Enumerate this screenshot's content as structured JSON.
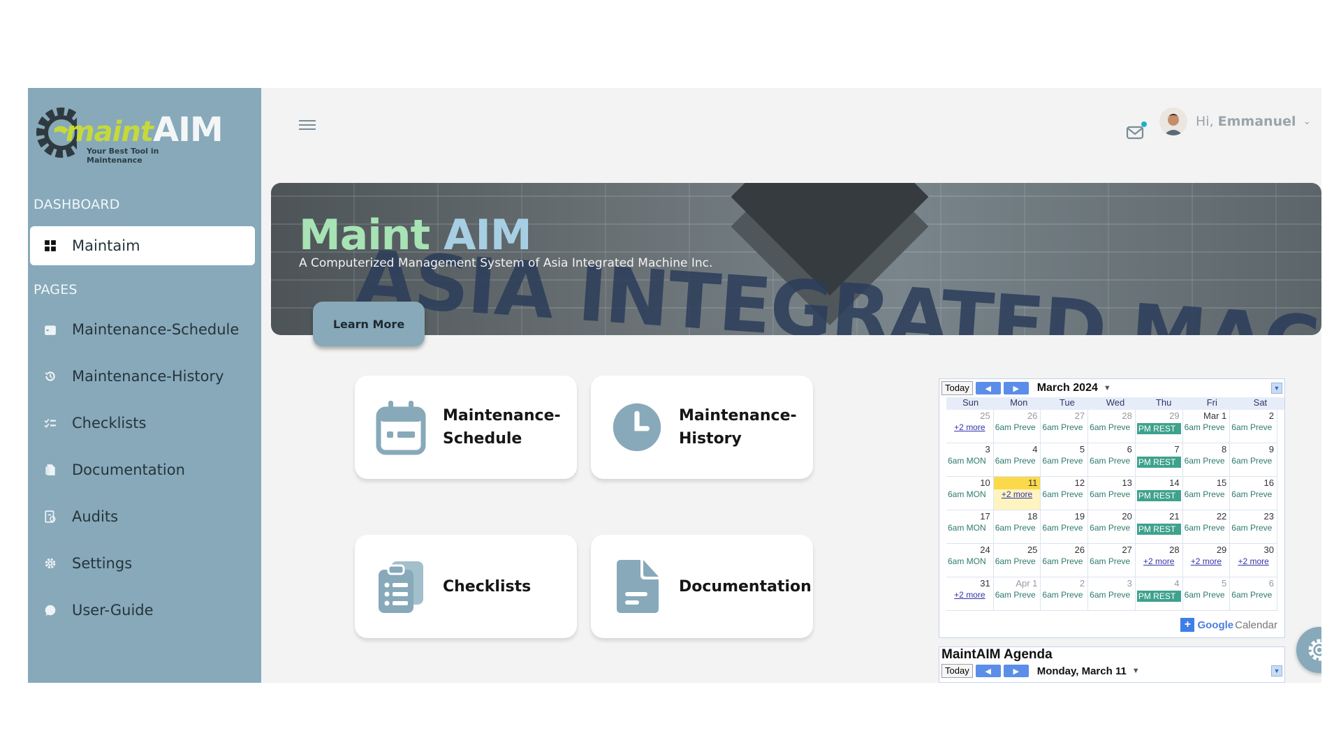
{
  "logo": {
    "word_a": "maint",
    "word_b": "AIM",
    "tagline": "Your Best Tool in Maintenance"
  },
  "sidebar": {
    "dashboard_heading": "DASHBOARD",
    "pages_heading": "PAGES",
    "active_item": {
      "label": "Maintaim",
      "icon": "grid-icon"
    },
    "items": [
      {
        "label": "Maintenance-Schedule",
        "icon": "calendar-icon"
      },
      {
        "label": "Maintenance-History",
        "icon": "history-icon"
      },
      {
        "label": "Checklists",
        "icon": "checklist-icon"
      },
      {
        "label": "Documentation",
        "icon": "document-icon"
      },
      {
        "label": "Audits",
        "icon": "audit-icon"
      },
      {
        "label": "Settings",
        "icon": "gear-icon"
      },
      {
        "label": "User-Guide",
        "icon": "chat-icon"
      }
    ]
  },
  "topbar": {
    "greeting_prefix": "Hi,",
    "user_name": "Emmanuel",
    "notification_dot": true
  },
  "banner": {
    "title_a": "Maint",
    "title_b": "AIM",
    "subtitle": "A Computerized Management System of Asia Integrated Machine Inc.",
    "background_text": "ASIA INTEGRATED MACHINE",
    "learn_more": "Learn More"
  },
  "cards": [
    {
      "line1": "Maintenance-",
      "line2": "Schedule",
      "icon": "calendar-icon"
    },
    {
      "line1": "Maintenance-",
      "line2": "History",
      "icon": "clock-icon"
    },
    {
      "line1": "Checklists",
      "line2": "",
      "icon": "clipboard-icon"
    },
    {
      "line1": "Documentation",
      "line2": "",
      "icon": "file-icon"
    }
  ],
  "calendar": {
    "today_label": "Today",
    "month_title": "March 2024",
    "weekdays": [
      "Sun",
      "Mon",
      "Tue",
      "Wed",
      "Thu",
      "Fri",
      "Sat"
    ],
    "weeks": [
      [
        {
          "d": "25",
          "o": true,
          "e": "+2 more",
          "t": "more"
        },
        {
          "d": "26",
          "o": true,
          "e": "6am Preve"
        },
        {
          "d": "27",
          "o": true,
          "e": "6am Preve"
        },
        {
          "d": "28",
          "o": true,
          "e": "6am Preve"
        },
        {
          "d": "29",
          "o": true,
          "e": "PM REST",
          "t": "pm"
        },
        {
          "d": "Mar 1",
          "e": "6am Preve"
        },
        {
          "d": "2",
          "e": "6am Preve"
        }
      ],
      [
        {
          "d": "3",
          "e": "6am MON"
        },
        {
          "d": "4",
          "e": "6am Preve"
        },
        {
          "d": "5",
          "e": "6am Preve"
        },
        {
          "d": "6",
          "e": "6am Preve"
        },
        {
          "d": "7",
          "e": "PM REST",
          "t": "pm"
        },
        {
          "d": "8",
          "e": "6am Preve"
        },
        {
          "d": "9",
          "e": "6am Preve"
        }
      ],
      [
        {
          "d": "10",
          "e": "6am MON"
        },
        {
          "d": "11",
          "e": "+2 more",
          "t": "more",
          "today": true
        },
        {
          "d": "12",
          "e": "6am Preve"
        },
        {
          "d": "13",
          "e": "6am Preve"
        },
        {
          "d": "14",
          "e": "PM REST",
          "t": "pm"
        },
        {
          "d": "15",
          "e": "6am Preve"
        },
        {
          "d": "16",
          "e": "6am Preve"
        }
      ],
      [
        {
          "d": "17",
          "e": "6am MON"
        },
        {
          "d": "18",
          "e": "6am Preve"
        },
        {
          "d": "19",
          "e": "6am Preve"
        },
        {
          "d": "20",
          "e": "6am Preve"
        },
        {
          "d": "21",
          "e": "PM REST",
          "t": "pm"
        },
        {
          "d": "22",
          "e": "6am Preve"
        },
        {
          "d": "23",
          "e": "6am Preve"
        }
      ],
      [
        {
          "d": "24",
          "e": "6am MON"
        },
        {
          "d": "25",
          "e": "6am Preve"
        },
        {
          "d": "26",
          "e": "6am Preve"
        },
        {
          "d": "27",
          "e": "6am Preve"
        },
        {
          "d": "28",
          "e": "+2 more",
          "t": "more"
        },
        {
          "d": "29",
          "e": "+2 more",
          "t": "more"
        },
        {
          "d": "30",
          "e": "+2 more",
          "t": "more"
        }
      ],
      [
        {
          "d": "31",
          "e": "+2 more",
          "t": "more"
        },
        {
          "d": "Apr 1",
          "o": true,
          "e": "6am Preve"
        },
        {
          "d": "2",
          "o": true,
          "e": "6am Preve"
        },
        {
          "d": "3",
          "o": true,
          "e": "6am Preve"
        },
        {
          "d": "4",
          "o": true,
          "e": "PM REST",
          "t": "pm"
        },
        {
          "d": "5",
          "o": true,
          "e": "6am Preve"
        },
        {
          "d": "6",
          "o": true,
          "e": "6am Preve"
        }
      ]
    ],
    "footer_google": "Google",
    "footer_calendar": "Calendar"
  },
  "agenda": {
    "title": "MaintAIM Agenda",
    "today_label": "Today",
    "date_title": "Monday, March 11"
  },
  "colors": {
    "sidebar": "#87a9ba",
    "accent_green": "#a7e3b4",
    "accent_blue": "#a7cfe3",
    "event_green": "#3fa28d"
  }
}
